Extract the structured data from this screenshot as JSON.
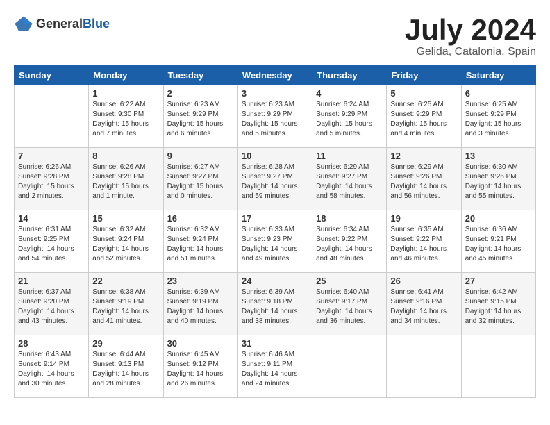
{
  "logo": {
    "text_general": "General",
    "text_blue": "Blue"
  },
  "title": {
    "month_year": "July 2024",
    "location": "Gelida, Catalonia, Spain"
  },
  "weekdays": [
    "Sunday",
    "Monday",
    "Tuesday",
    "Wednesday",
    "Thursday",
    "Friday",
    "Saturday"
  ],
  "weeks": [
    [
      {
        "day": "",
        "info": ""
      },
      {
        "day": "1",
        "info": "Sunrise: 6:22 AM\nSunset: 9:30 PM\nDaylight: 15 hours\nand 7 minutes."
      },
      {
        "day": "2",
        "info": "Sunrise: 6:23 AM\nSunset: 9:29 PM\nDaylight: 15 hours\nand 6 minutes."
      },
      {
        "day": "3",
        "info": "Sunrise: 6:23 AM\nSunset: 9:29 PM\nDaylight: 15 hours\nand 5 minutes."
      },
      {
        "day": "4",
        "info": "Sunrise: 6:24 AM\nSunset: 9:29 PM\nDaylight: 15 hours\nand 5 minutes."
      },
      {
        "day": "5",
        "info": "Sunrise: 6:25 AM\nSunset: 9:29 PM\nDaylight: 15 hours\nand 4 minutes."
      },
      {
        "day": "6",
        "info": "Sunrise: 6:25 AM\nSunset: 9:29 PM\nDaylight: 15 hours\nand 3 minutes."
      }
    ],
    [
      {
        "day": "7",
        "info": "Sunrise: 6:26 AM\nSunset: 9:28 PM\nDaylight: 15 hours\nand 2 minutes."
      },
      {
        "day": "8",
        "info": "Sunrise: 6:26 AM\nSunset: 9:28 PM\nDaylight: 15 hours\nand 1 minute."
      },
      {
        "day": "9",
        "info": "Sunrise: 6:27 AM\nSunset: 9:27 PM\nDaylight: 15 hours\nand 0 minutes."
      },
      {
        "day": "10",
        "info": "Sunrise: 6:28 AM\nSunset: 9:27 PM\nDaylight: 14 hours\nand 59 minutes."
      },
      {
        "day": "11",
        "info": "Sunrise: 6:29 AM\nSunset: 9:27 PM\nDaylight: 14 hours\nand 58 minutes."
      },
      {
        "day": "12",
        "info": "Sunrise: 6:29 AM\nSunset: 9:26 PM\nDaylight: 14 hours\nand 56 minutes."
      },
      {
        "day": "13",
        "info": "Sunrise: 6:30 AM\nSunset: 9:26 PM\nDaylight: 14 hours\nand 55 minutes."
      }
    ],
    [
      {
        "day": "14",
        "info": "Sunrise: 6:31 AM\nSunset: 9:25 PM\nDaylight: 14 hours\nand 54 minutes."
      },
      {
        "day": "15",
        "info": "Sunrise: 6:32 AM\nSunset: 9:24 PM\nDaylight: 14 hours\nand 52 minutes."
      },
      {
        "day": "16",
        "info": "Sunrise: 6:32 AM\nSunset: 9:24 PM\nDaylight: 14 hours\nand 51 minutes."
      },
      {
        "day": "17",
        "info": "Sunrise: 6:33 AM\nSunset: 9:23 PM\nDaylight: 14 hours\nand 49 minutes."
      },
      {
        "day": "18",
        "info": "Sunrise: 6:34 AM\nSunset: 9:22 PM\nDaylight: 14 hours\nand 48 minutes."
      },
      {
        "day": "19",
        "info": "Sunrise: 6:35 AM\nSunset: 9:22 PM\nDaylight: 14 hours\nand 46 minutes."
      },
      {
        "day": "20",
        "info": "Sunrise: 6:36 AM\nSunset: 9:21 PM\nDaylight: 14 hours\nand 45 minutes."
      }
    ],
    [
      {
        "day": "21",
        "info": "Sunrise: 6:37 AM\nSunset: 9:20 PM\nDaylight: 14 hours\nand 43 minutes."
      },
      {
        "day": "22",
        "info": "Sunrise: 6:38 AM\nSunset: 9:19 PM\nDaylight: 14 hours\nand 41 minutes."
      },
      {
        "day": "23",
        "info": "Sunrise: 6:39 AM\nSunset: 9:19 PM\nDaylight: 14 hours\nand 40 minutes."
      },
      {
        "day": "24",
        "info": "Sunrise: 6:39 AM\nSunset: 9:18 PM\nDaylight: 14 hours\nand 38 minutes."
      },
      {
        "day": "25",
        "info": "Sunrise: 6:40 AM\nSunset: 9:17 PM\nDaylight: 14 hours\nand 36 minutes."
      },
      {
        "day": "26",
        "info": "Sunrise: 6:41 AM\nSunset: 9:16 PM\nDaylight: 14 hours\nand 34 minutes."
      },
      {
        "day": "27",
        "info": "Sunrise: 6:42 AM\nSunset: 9:15 PM\nDaylight: 14 hours\nand 32 minutes."
      }
    ],
    [
      {
        "day": "28",
        "info": "Sunrise: 6:43 AM\nSunset: 9:14 PM\nDaylight: 14 hours\nand 30 minutes."
      },
      {
        "day": "29",
        "info": "Sunrise: 6:44 AM\nSunset: 9:13 PM\nDaylight: 14 hours\nand 28 minutes."
      },
      {
        "day": "30",
        "info": "Sunrise: 6:45 AM\nSunset: 9:12 PM\nDaylight: 14 hours\nand 26 minutes."
      },
      {
        "day": "31",
        "info": "Sunrise: 6:46 AM\nSunset: 9:11 PM\nDaylight: 14 hours\nand 24 minutes."
      },
      {
        "day": "",
        "info": ""
      },
      {
        "day": "",
        "info": ""
      },
      {
        "day": "",
        "info": ""
      }
    ]
  ]
}
